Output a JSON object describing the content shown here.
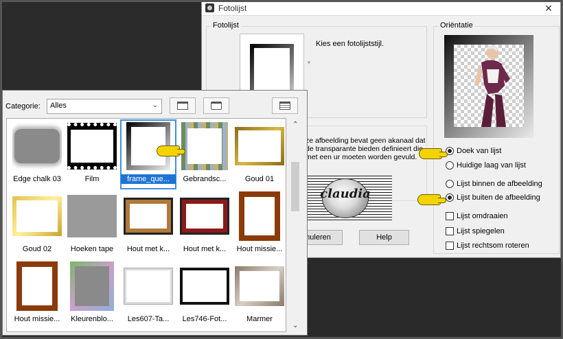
{
  "dialog": {
    "title": "Fotolijst",
    "close_glyph": "✕",
    "fotolijst_group": "Fotolijst",
    "frame_prompt": "Kies een fotolijststijl.",
    "message": "ze afbeelding bevat geen akanaal dat de transparante bieden definieert die met een ur moeten worden gevuld.",
    "orientation_group": "Oriëntatie",
    "radio_doek": "Doek van lijst",
    "radio_huidige": "Huidige laag van lijst",
    "radio_binnen": "Lijst binnen de afbeelding",
    "radio_buiten": "Lijst buiten de afbeelding",
    "check_omdraaien": "Lijst omdraaien",
    "check_spiegelen": "Lijst spiegelen",
    "check_roteren": "Lijst rechtsom roteren",
    "cancel_label": "nuleren",
    "help_label": "Help"
  },
  "watermark": {
    "text": "claudia"
  },
  "picker": {
    "category_label": "Categorie:",
    "category_value": "Alles",
    "tiles": [
      "Edge chalk 03",
      "Film",
      "frame_que...",
      "Gebrandsc...",
      "Goud 01",
      "Goud 02",
      "Hoeken tape",
      "Hout met k...",
      "Hout met k...",
      "Hout missie...",
      "Hout missie...",
      "Kleurenblo...",
      "Les607-Ta...",
      "Les746-Fot...",
      "Marmer"
    ]
  },
  "colors": {
    "selection": "#1e74d6",
    "gold": "#c9a227",
    "wood": "#8b4513",
    "pointer_yellow": "#f3d400"
  },
  "icons": [
    "app-icon",
    "close-icon",
    "dropdown-arrow-icon",
    "view-large-icon",
    "view-list-icon",
    "view-details-icon",
    "scroll-up-icon",
    "scroll-down-icon",
    "pointer-hand-icon"
  ]
}
